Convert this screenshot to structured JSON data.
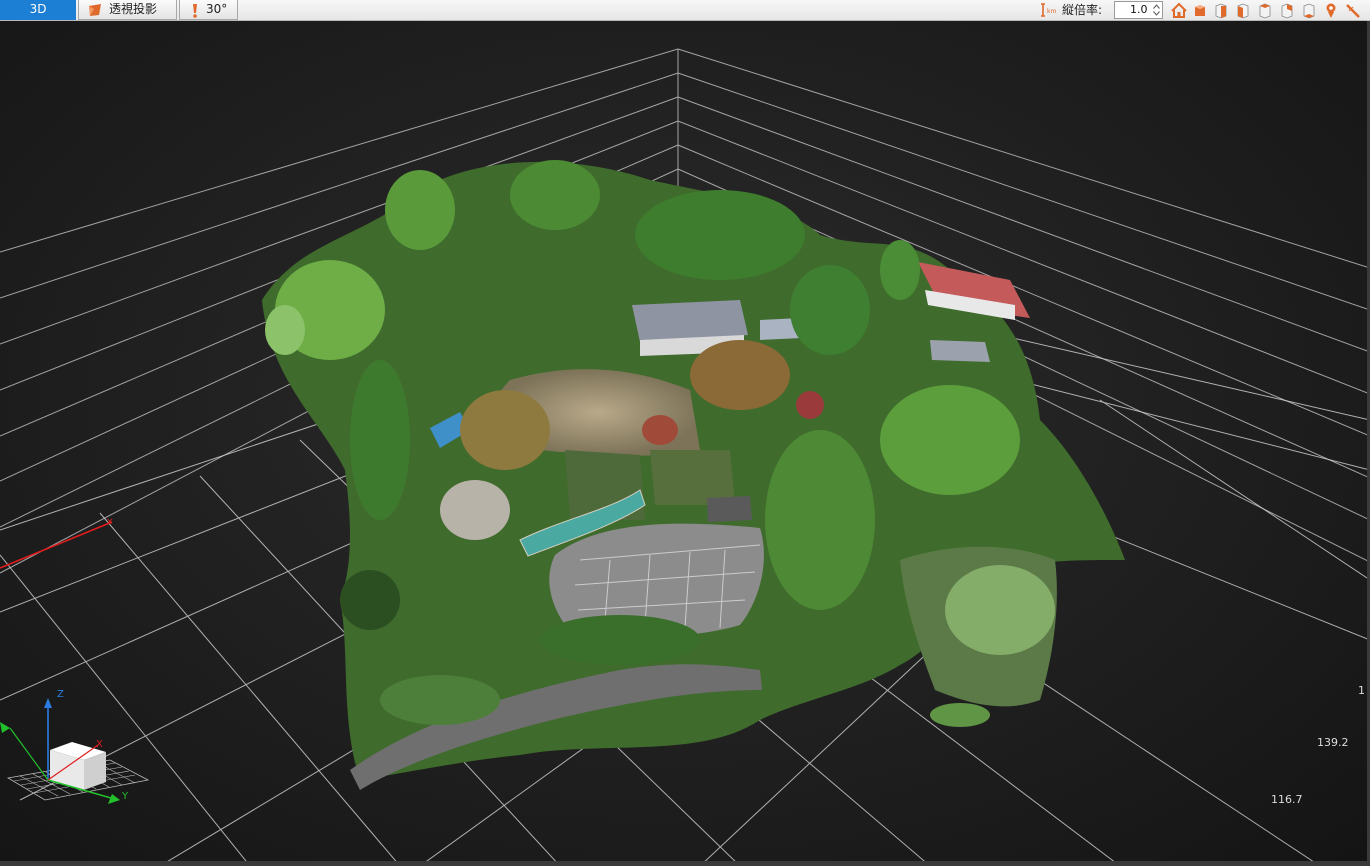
{
  "toolbar": {
    "tab_3d": "3D",
    "tab_projection": "透視投影",
    "tab_angle": "30°",
    "vertical_exaggeration_label": "縦倍率:",
    "vertical_exaggeration_value": "1.0",
    "view_buttons": [
      "home-icon",
      "view-front-icon",
      "view-right-icon",
      "view-left-icon",
      "view-top-icon",
      "view-back-icon",
      "view-bottom-icon",
      "marker-icon",
      "measure-icon"
    ]
  },
  "viewport": {
    "scale_labels": {
      "top": "1",
      "middle": "139.2",
      "bottom": "116.7"
    },
    "axis_gizmo": {
      "z_label": "Z",
      "x_label": "X",
      "y_label": "Y"
    }
  },
  "colors": {
    "accent_blue": "#1c7fd4",
    "icon_orange": "#e06a2c",
    "grid_line": "#d8d8d8",
    "x_axis": "#e01c1c",
    "y_axis": "#22c02a",
    "z_axis": "#2b7de0"
  }
}
